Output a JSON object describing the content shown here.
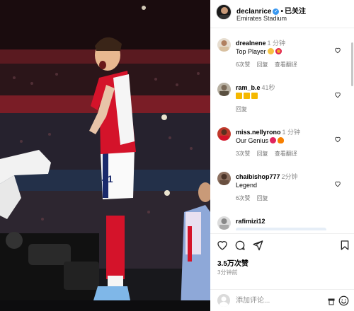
{
  "post": {
    "username": "declanrice",
    "verified_mark": "✓",
    "separator": "•",
    "follow_label": "已关注",
    "location": "Emirates Stadium"
  },
  "comments": [
    {
      "user": "drealnene",
      "time": "1 分钟",
      "text": "Top Player",
      "emoji": [
        "clap-emoji",
        "heart-eyes-emoji"
      ],
      "likes": "6次赞",
      "reply": "回复",
      "translate": "查看翻译"
    },
    {
      "user": "ram_b.e",
      "time": "41秒",
      "text": "",
      "emoji": [
        "crown-emoji",
        "crown-emoji",
        "crown-emoji"
      ],
      "reply": "回复"
    },
    {
      "user": "miss.nellyrono",
      "time": "1 分钟",
      "text": "Our Genius",
      "emoji": [
        "red-heart-emoji",
        "fire-emoji"
      ],
      "likes": "3次赞",
      "reply": "回复",
      "translate": "查看翻译"
    },
    {
      "user": "chaibishop777",
      "time": "2分钟",
      "text": "Legend",
      "emoji": [],
      "likes": "6次赞",
      "reply": "回复"
    },
    {
      "user": "rafimizi12"
    }
  ],
  "actions": {
    "likes_count": "3.5万次赞",
    "posted_ago": "3分钟前",
    "comment_placeholder": "添加评论..."
  },
  "photo": {
    "jersey_number": "41"
  },
  "colors": {
    "accent": "#3897f0",
    "arsenal_red": "#d4132a"
  }
}
